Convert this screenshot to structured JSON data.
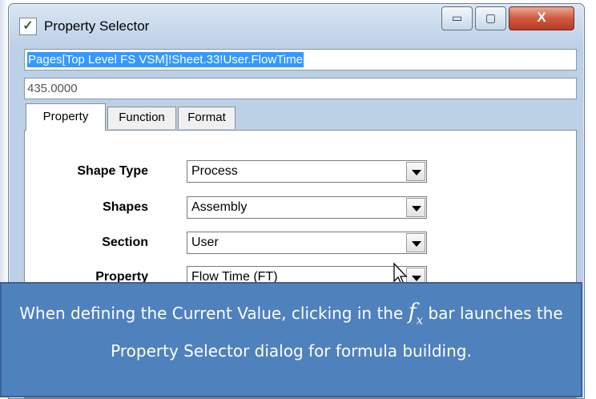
{
  "window": {
    "title": "Property Selector",
    "icon": "fx-dialog-icon",
    "controls": {
      "minimize": "▭",
      "maximize": "▢",
      "close": "X"
    }
  },
  "formula": {
    "text": "Pages[Top Level FS VSM]!Sheet.33!User.FlowTime",
    "selected": true
  },
  "value_field": {
    "text": "435.0000"
  },
  "tabs": [
    {
      "label": "Property",
      "active": true
    },
    {
      "label": "Function",
      "active": false
    },
    {
      "label": "Format",
      "active": false
    }
  ],
  "fields": [
    {
      "label": "Shape Type",
      "value": "Process"
    },
    {
      "label": "Shapes",
      "value": "Assembly"
    },
    {
      "label": "Section",
      "value": "User"
    },
    {
      "label": "Property",
      "value": "Flow Time (FT)"
    }
  ],
  "caption": {
    "before": "When defining the Current Value, clicking in the",
    "fx_symbol": "f",
    "fx_subscript": "x",
    "after": "bar launches the Property Selector dialog for formula building."
  },
  "colors": {
    "accent": "#4f81bd",
    "selection": "#3399ff",
    "close": "#cf5a3f"
  }
}
